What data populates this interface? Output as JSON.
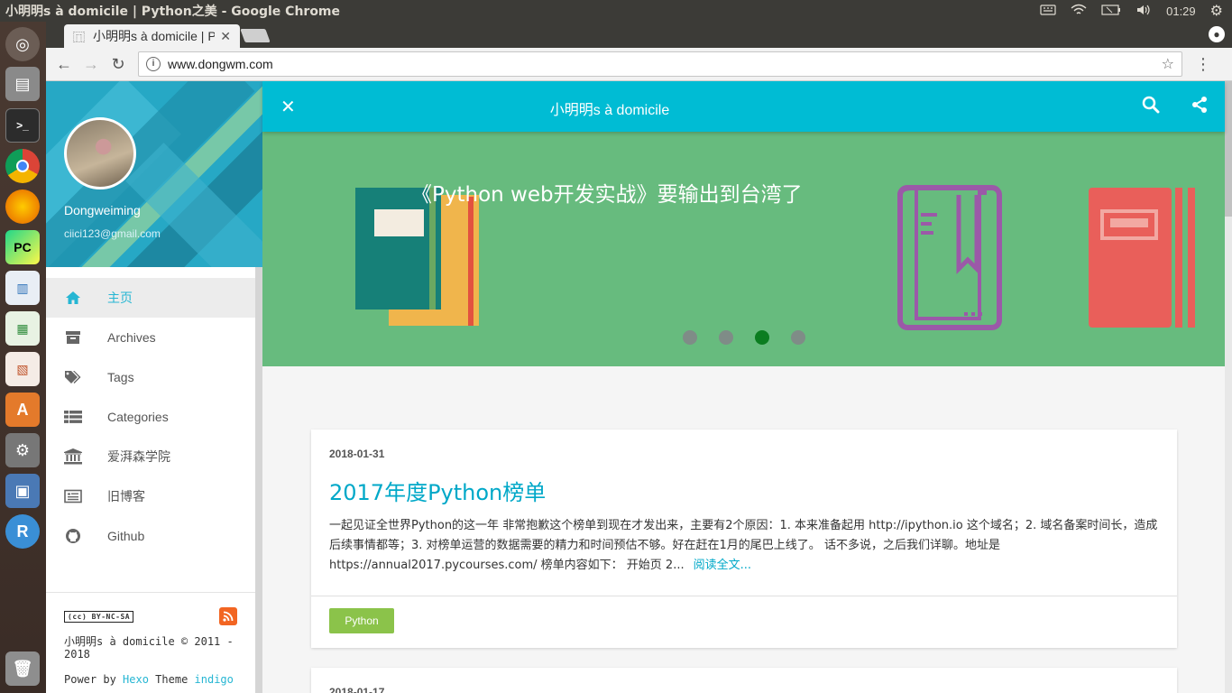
{
  "os": {
    "window_title": "小明明s à domicile | Python之美 - Google Chrome",
    "clock": "01:29"
  },
  "browser": {
    "tab_title": "小明明s à domicile | Py",
    "url": "www.dongwm.com"
  },
  "sidebar": {
    "name": "Dongweiming",
    "email": "ciici123@gmail.com",
    "menu": [
      {
        "label": "主页",
        "icon": "home-icon"
      },
      {
        "label": "Archives",
        "icon": "archive-icon"
      },
      {
        "label": "Tags",
        "icon": "tags-icon"
      },
      {
        "label": "Categories",
        "icon": "list-icon"
      },
      {
        "label": "爱湃森学院",
        "icon": "institution-icon"
      },
      {
        "label": "旧博客",
        "icon": "newspaper-icon"
      },
      {
        "label": "Github",
        "icon": "github-icon"
      }
    ],
    "license": "BY-NC-SA",
    "copyright": "小明明s à domicile © 2011 - 2018",
    "power_prefix": "Power by",
    "power_hexo": "Hexo",
    "power_theme": "Theme",
    "power_indigo": "indigo"
  },
  "appbar": {
    "title": "小明明s à domicile"
  },
  "banner": {
    "title": "《Python web开发实战》要输出到台湾了",
    "slide_count": 4,
    "active_slide": 3,
    "background": "#67bb7e"
  },
  "posts": [
    {
      "date": "2018-01-31",
      "title": "2017年度Python榜单",
      "excerpt": "一起见证全世界Python的这一年 非常抱歉这个榜单到现在才发出来，主要有2个原因：1. 本来准备起用 http://ipython.io 这个域名；2. 域名备案时间长，造成后续事情都等；3. 对榜单运营的数据需要的精力和时间预估不够。好在赶在1月的尾巴上线了。 话不多说，之后我们详聊。地址是 https://annual2017.pycourses.com/ 榜单内容如下： 开始页 2...",
      "read_more": "阅读全文...",
      "tag": "Python"
    },
    {
      "date": "2018-01-17"
    }
  ],
  "colors": {
    "accent": "#00bcd4",
    "link": "#00a8c8",
    "tag": "#8bc34a"
  }
}
